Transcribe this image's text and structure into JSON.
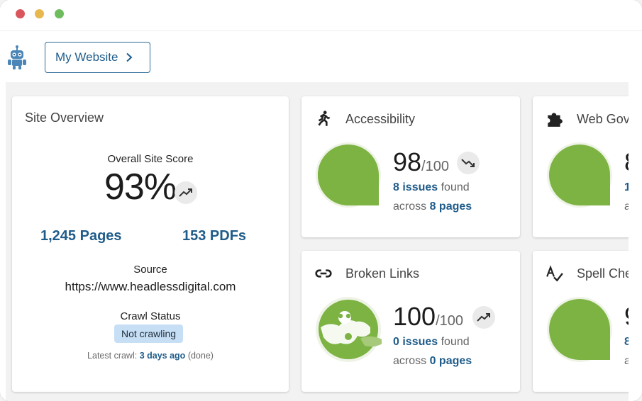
{
  "header": {
    "site_button_label": "My Website"
  },
  "overview": {
    "title": "Site Overview",
    "score_label": "Overall Site Score",
    "score": "93%",
    "pages": "1,245 Pages",
    "pdfs": "153 PDFs",
    "source_label": "Source",
    "source_url": "https://www.headlessdigital.com",
    "crawl_label": "Crawl Status",
    "crawl_status": "Not crawling",
    "latest_prefix": "Latest crawl:",
    "latest_value": "3 days ago",
    "latest_suffix": "(done)"
  },
  "accessibility": {
    "title": "Accessibility",
    "score": "98",
    "denom": "/100",
    "issues_count": "8 issues",
    "issues_suffix": "found",
    "pages_prefix": "across",
    "pages_count": "8 pages"
  },
  "broken_links": {
    "title": "Broken Links",
    "score": "100",
    "denom": "/100",
    "issues_count": "0 issues",
    "issues_suffix": "found",
    "pages_prefix": "across",
    "pages_count": "0 pages"
  },
  "web_governance": {
    "title": "Web Governance",
    "score_partial": "8",
    "issues_partial": "1",
    "pages_partial": "a"
  },
  "spell_check": {
    "title": "Spell Check",
    "score_partial": "9",
    "issues_partial": "8",
    "pages_partial": "a"
  },
  "colors": {
    "brand_blue": "#1f5c8a",
    "gauge_green": "#7cb342",
    "chip_bg": "#c7dff5"
  }
}
